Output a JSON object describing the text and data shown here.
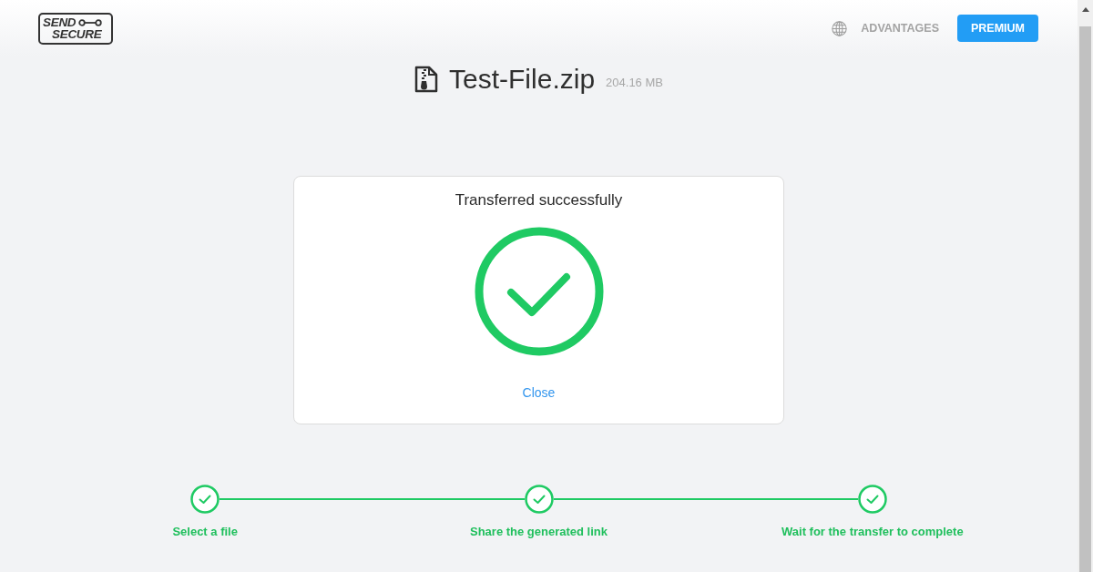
{
  "logo": {
    "line_1": "SEND",
    "line_2": "SECURE"
  },
  "nav": {
    "link": "ADVANTAGES",
    "button": "PREMIUM"
  },
  "file": {
    "name": "Test-File.zip",
    "size": "204.16 MB"
  },
  "dialog": {
    "title": "Transferred successfully",
    "link": "Close"
  },
  "steps": [
    {
      "label": "Select a file",
      "done": true
    },
    {
      "label": "Share the generated link",
      "done": true
    },
    {
      "label": "Wait for the transfer to complete",
      "done": true
    }
  ]
}
